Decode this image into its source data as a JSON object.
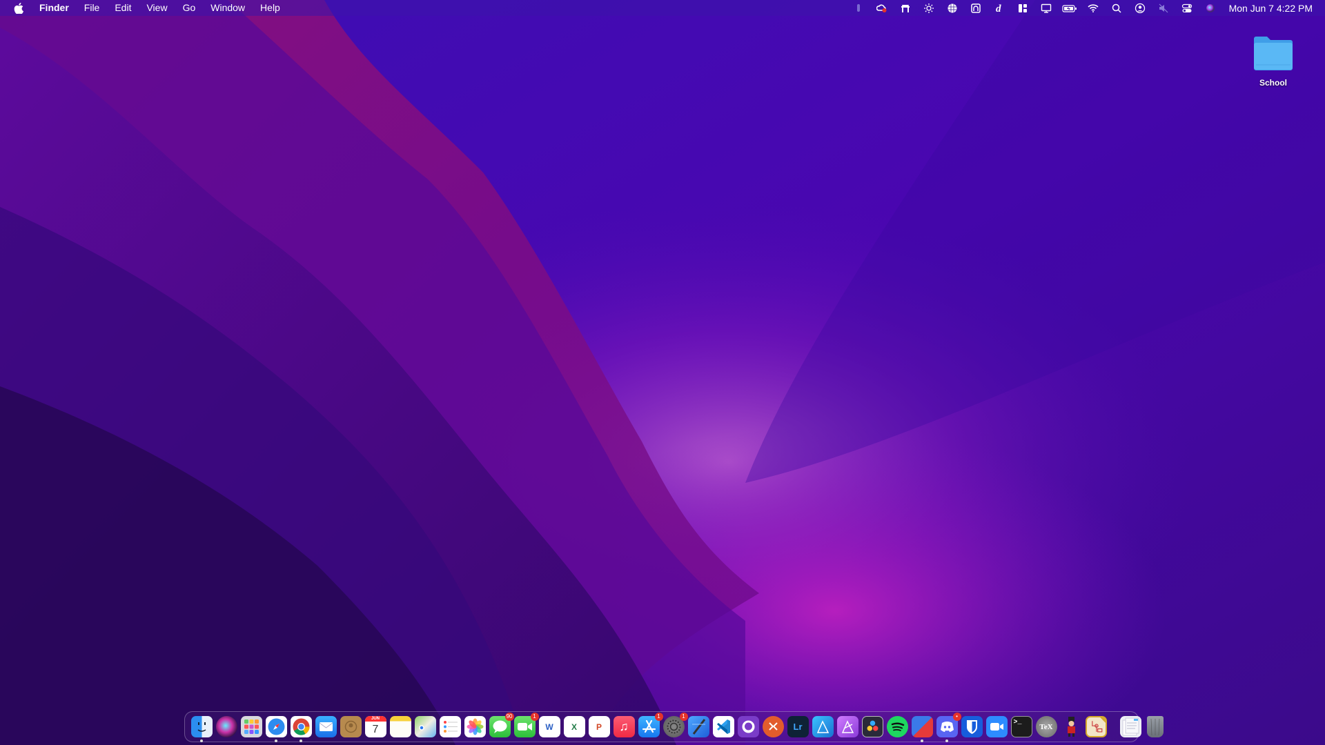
{
  "menubar": {
    "app_name": "Finder",
    "menus": [
      "File",
      "Edit",
      "View",
      "Go",
      "Window",
      "Help"
    ],
    "status_icons": [
      "microphone-indicator-icon",
      "creative-cloud-icon",
      "menubar-app-icon",
      "brightness-icon",
      "globe-icon",
      "headphones-app-icon",
      "dictionary-icon",
      "layout-icon",
      "display-icon",
      "battery-charging-icon",
      "wifi-icon",
      "spotlight-search-icon",
      "user-account-icon",
      "mute-icon",
      "control-center-icon",
      "siri-icon"
    ],
    "clock": "Mon Jun 7  4:22 PM"
  },
  "desktop": {
    "items": [
      {
        "label": "School",
        "icon": "folder-icon"
      }
    ]
  },
  "colors": {
    "accent": "#5a0fc8",
    "badge": "#e5332a",
    "folder": "#56b4f4"
  },
  "dock": {
    "apps": [
      {
        "name": "Finder",
        "icon": "finder-icon",
        "running": true
      },
      {
        "name": "Siri",
        "icon": "siri-icon"
      },
      {
        "name": "Launchpad",
        "icon": "launchpad-icon"
      },
      {
        "name": "Safari",
        "icon": "safari-icon",
        "running": true
      },
      {
        "name": "Google Chrome",
        "icon": "chrome-icon",
        "running": true
      },
      {
        "name": "Mail",
        "icon": "mail-icon"
      },
      {
        "name": "Contacts",
        "icon": "contacts-icon"
      },
      {
        "name": "Calendar",
        "icon": "calendar-icon",
        "text": "7",
        "month": "JUN"
      },
      {
        "name": "Notes",
        "icon": "notes-icon"
      },
      {
        "name": "Maps",
        "icon": "maps-icon"
      },
      {
        "name": "Reminders",
        "icon": "reminders-icon"
      },
      {
        "name": "Photos",
        "icon": "photos-icon"
      },
      {
        "name": "Messages",
        "icon": "messages-icon",
        "badge": "90"
      },
      {
        "name": "FaceTime",
        "icon": "facetime-icon",
        "badge": "1"
      },
      {
        "name": "Microsoft Word",
        "icon": "word-icon",
        "text": "W"
      },
      {
        "name": "Microsoft Excel",
        "icon": "excel-icon",
        "text": "X"
      },
      {
        "name": "Microsoft PowerPoint",
        "icon": "powerpoint-icon",
        "text": "P"
      },
      {
        "name": "Music",
        "icon": "music-icon",
        "text": "♫"
      },
      {
        "name": "App Store",
        "icon": "app-store-icon",
        "badge": "1"
      },
      {
        "name": "System Preferences",
        "icon": "system-preferences-icon",
        "badge": "1"
      },
      {
        "name": "Xcode",
        "icon": "xcode-icon"
      },
      {
        "name": "Visual Studio Code",
        "icon": "vscode-icon"
      },
      {
        "name": "GitHub Desktop",
        "icon": "github-icon"
      },
      {
        "name": "Microsoft Remote Desktop",
        "icon": "remote-desktop-icon"
      },
      {
        "name": "Lightroom",
        "icon": "lightroom-icon",
        "text": "Lr"
      },
      {
        "name": "Affinity Designer",
        "icon": "affinity-designer-icon"
      },
      {
        "name": "Affinity Photo",
        "icon": "affinity-photo-icon"
      },
      {
        "name": "DaVinci Resolve",
        "icon": "davinci-resolve-icon"
      },
      {
        "name": "Spotify",
        "icon": "spotify-icon"
      },
      {
        "name": "Parallels",
        "icon": "parallels-icon",
        "running": true
      },
      {
        "name": "Discord",
        "icon": "discord-icon",
        "badge": "•",
        "running": true
      },
      {
        "name": "Bitwarden",
        "icon": "bitwarden-icon"
      },
      {
        "name": "Zoom",
        "icon": "zoom-icon"
      },
      {
        "name": "Terminal",
        "icon": "terminal-icon",
        "text": ">_"
      },
      {
        "name": "TeX Live Utility",
        "icon": "tex-icon",
        "text": "TeX"
      },
      {
        "name": "Nutcracker App",
        "icon": "nutcracker-icon"
      },
      {
        "name": "LibreOffice Draw",
        "icon": "draw-icon"
      }
    ],
    "others": [
      {
        "name": "Documents Stack",
        "icon": "documents-stack-icon"
      },
      {
        "name": "Trash",
        "icon": "trash-icon"
      }
    ]
  }
}
